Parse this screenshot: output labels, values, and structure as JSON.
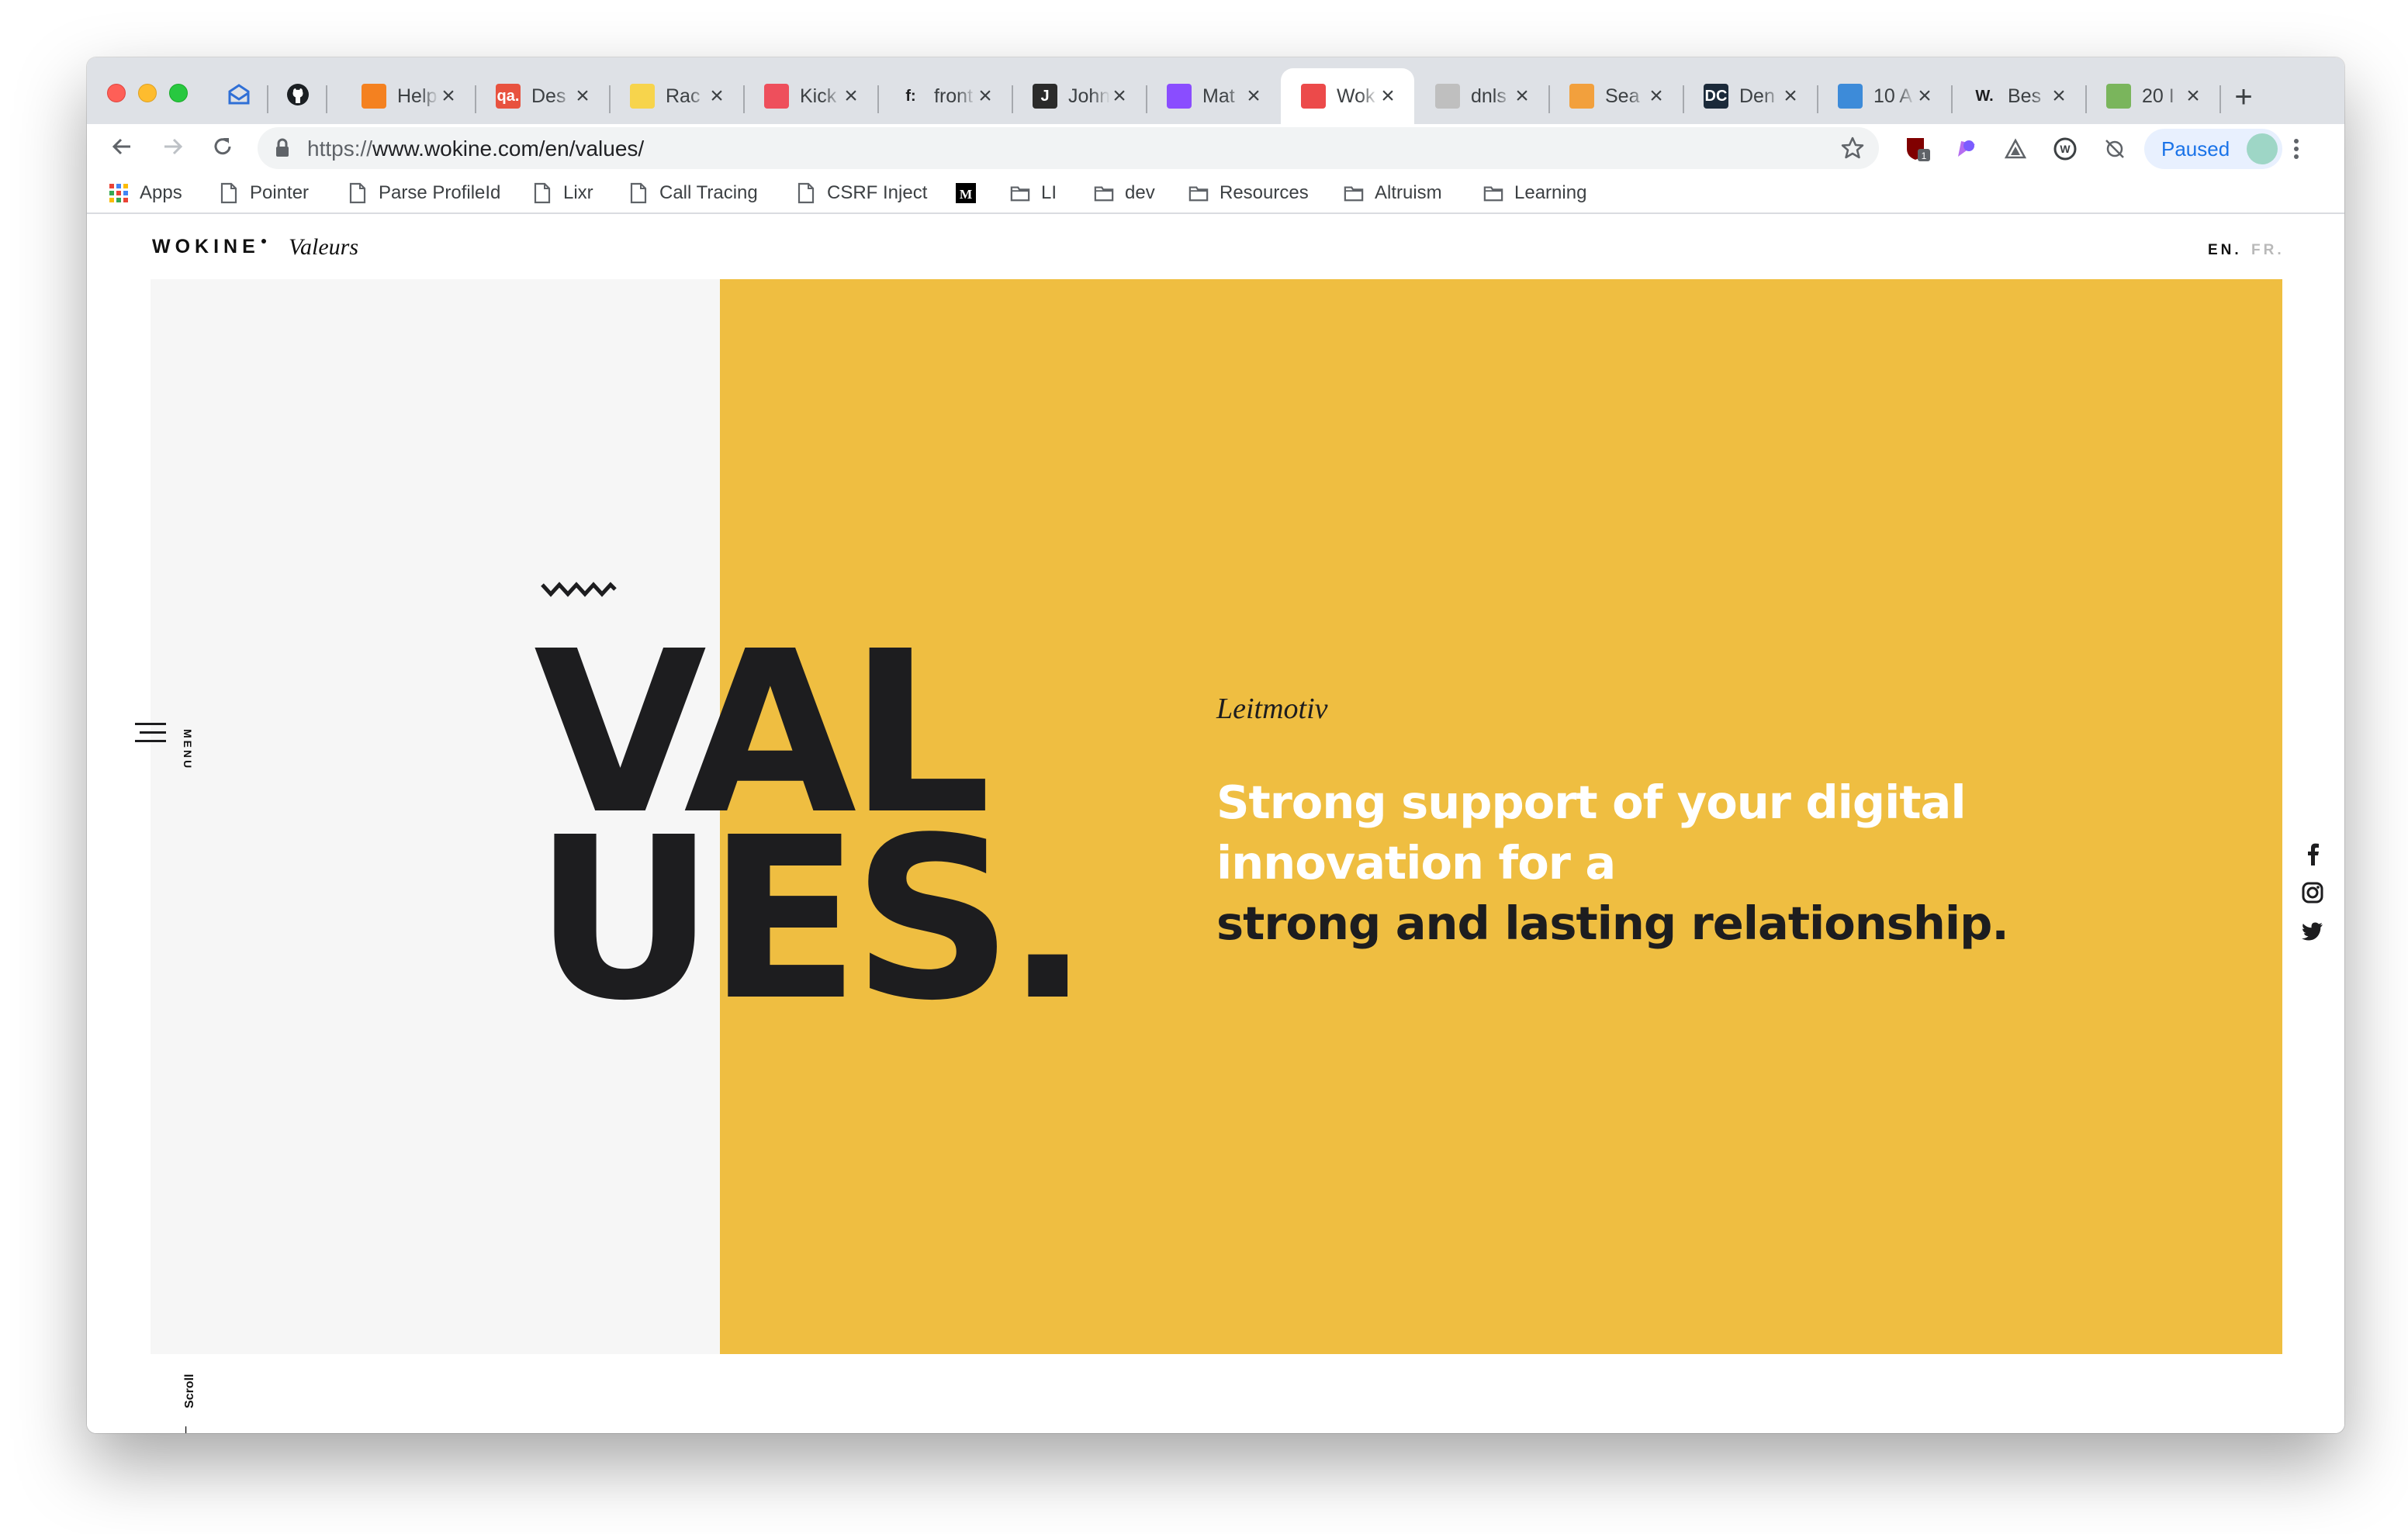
{
  "browser": {
    "tabs": [
      {
        "label": "Help",
        "favicon_color": "#f48120"
      },
      {
        "label": "Des",
        "favicon_text": "qa.",
        "favicon_color": "#e8523f"
      },
      {
        "label": "Rac",
        "favicon_color": "#f7d44c"
      },
      {
        "label": "Kick",
        "favicon_color": "#ee4f5c"
      },
      {
        "label": "front",
        "favicon_text": "f:",
        "favicon_color": "#ffffff"
      },
      {
        "label": "John",
        "favicon_text": "J",
        "favicon_color": "#2b2b2b"
      },
      {
        "label": "Mat",
        "favicon_color": "#8a4dff"
      },
      {
        "label": "Wok",
        "favicon_color": "#ec4a4a",
        "active": true
      },
      {
        "label": "dnls",
        "favicon_color": "#bfbfbf"
      },
      {
        "label": "Sea",
        "favicon_color": "#f2a03d"
      },
      {
        "label": "Den",
        "favicon_text": "DC",
        "favicon_color": "#1b2a3a"
      },
      {
        "label": "10 A",
        "favicon_color": "#3d8bd9"
      },
      {
        "label": "Bes",
        "favicon_text": "W.",
        "favicon_color": "#ffffff"
      },
      {
        "label": "20 I",
        "favicon_color": "#7ab55c"
      }
    ],
    "url_scheme": "https://",
    "url_rest": "www.wokine.com/en/values/",
    "profile_status": "Paused"
  },
  "bookmarks": {
    "apps": "Apps",
    "items": [
      {
        "label": "Pointer",
        "kind": "page"
      },
      {
        "label": "Parse ProfileId",
        "kind": "page"
      },
      {
        "label": "Lixr",
        "kind": "page"
      },
      {
        "label": "Call Tracing",
        "kind": "page"
      },
      {
        "label": "CSRF Inject",
        "kind": "page"
      },
      {
        "label": "",
        "kind": "medium"
      },
      {
        "label": "LI",
        "kind": "folder"
      },
      {
        "label": "dev",
        "kind": "folder"
      },
      {
        "label": "Resources",
        "kind": "folder"
      },
      {
        "label": "Altruism",
        "kind": "folder"
      },
      {
        "label": "Learning",
        "kind": "folder"
      }
    ]
  },
  "site": {
    "brand": "WOKINE",
    "brand_sub": "Valeurs",
    "lang_en": "EN.",
    "lang_fr": "FR.",
    "menu_label": "MENU",
    "scroll_label": "Scroll",
    "scroll_arrow": "↓",
    "title_line1": "VAL",
    "title_line2": "UES.",
    "leitmotiv": "Leitmotiv",
    "tagline_line1": "Strong support of your digital",
    "tagline_line2": "innovation for a",
    "tagline_line3": "strong and lasting relationship.",
    "colors": {
      "yellow": "#efbe41",
      "ink": "#1d1d1f",
      "panel_gray": "#f6f6f6"
    }
  }
}
